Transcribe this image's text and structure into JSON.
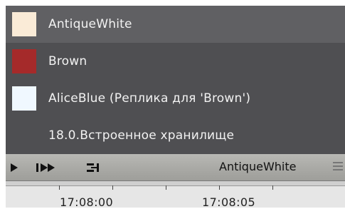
{
  "menu": {
    "items": [
      {
        "label": "AntiqueWhite",
        "swatch": "#faebd7",
        "highlighted": true
      },
      {
        "label": "Brown",
        "swatch": "#a52a2a"
      },
      {
        "label": "AliceBlue (Реплика для 'Brown')",
        "swatch": "#f0f8ff"
      },
      {
        "label": "18.0.Встроенное хранилище"
      }
    ]
  },
  "toolbar": {
    "play_icon": "play-icon",
    "step_forward_icon": "step-forward-icon",
    "export_icon": "export-icon",
    "archive_label": "AntiqueWhite",
    "menu_icon": "menu-grip-icon"
  },
  "timeline": {
    "times": [
      "17:08:00",
      "17:08:05"
    ]
  }
}
